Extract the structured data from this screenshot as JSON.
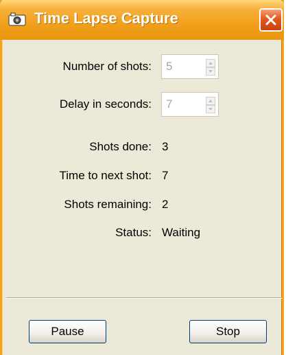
{
  "window": {
    "title": "Time Lapse Capture"
  },
  "fields": {
    "number_of_shots": {
      "label": "Number of shots:",
      "value": "5"
    },
    "delay_in_seconds": {
      "label": "Delay in seconds:",
      "value": "7"
    }
  },
  "stats": {
    "shots_done": {
      "label": "Shots done:",
      "value": "3"
    },
    "time_to_next": {
      "label": "Time to next shot:",
      "value": "7"
    },
    "shots_remaining": {
      "label": "Shots remaining:",
      "value": "2"
    },
    "status": {
      "label": "Status:",
      "value": "Waiting"
    }
  },
  "buttons": {
    "pause": "Pause",
    "stop": "Stop"
  },
  "colors": {
    "title_bar": "#f3a21f",
    "close": "#e05a1e",
    "window_bg": "#ece9d8"
  },
  "icons": {
    "app": "camera-icon",
    "close": "close-icon"
  }
}
